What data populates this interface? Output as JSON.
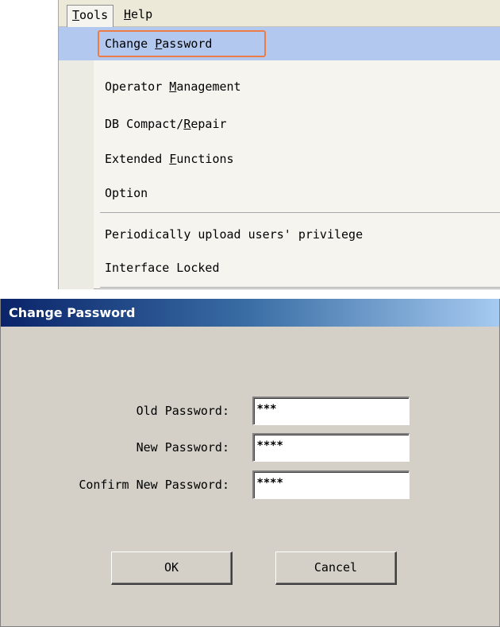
{
  "menubar": {
    "tools_label": "Tools",
    "tools_underline": "T",
    "tools_rest": "ools",
    "help_underline": "H",
    "help_rest": "elp"
  },
  "tools_menu": {
    "items": [
      {
        "pre": "Change ",
        "key": "P",
        "post": "assword"
      },
      {
        "pre": "Operator ",
        "key": "M",
        "post": "anagement"
      },
      {
        "pre": "DB Compact/",
        "key": "R",
        "post": "epair"
      },
      {
        "pre": "Extended ",
        "key": "F",
        "post": "unctions"
      },
      {
        "pre": "Option",
        "key": "",
        "post": ""
      },
      {
        "pre": "Periodically upload users' privilege",
        "key": "",
        "post": ""
      },
      {
        "pre": "Interface Locked",
        "key": "",
        "post": ""
      }
    ]
  },
  "dialog": {
    "title": "Change Password",
    "old_label": "Old Password:",
    "old_value": "***",
    "new_label": "New Password:",
    "new_value": "****",
    "confirm_label": "Confirm New Password:",
    "confirm_value": "****",
    "ok_label": "OK",
    "cancel_label": "Cancel"
  },
  "colors": {
    "highlight": "#b3c8ef",
    "focus_ring": "#ec7b45",
    "title_start": "#0a246a",
    "title_end": "#a6caf0",
    "dialog_bg": "#d4d0c8"
  }
}
